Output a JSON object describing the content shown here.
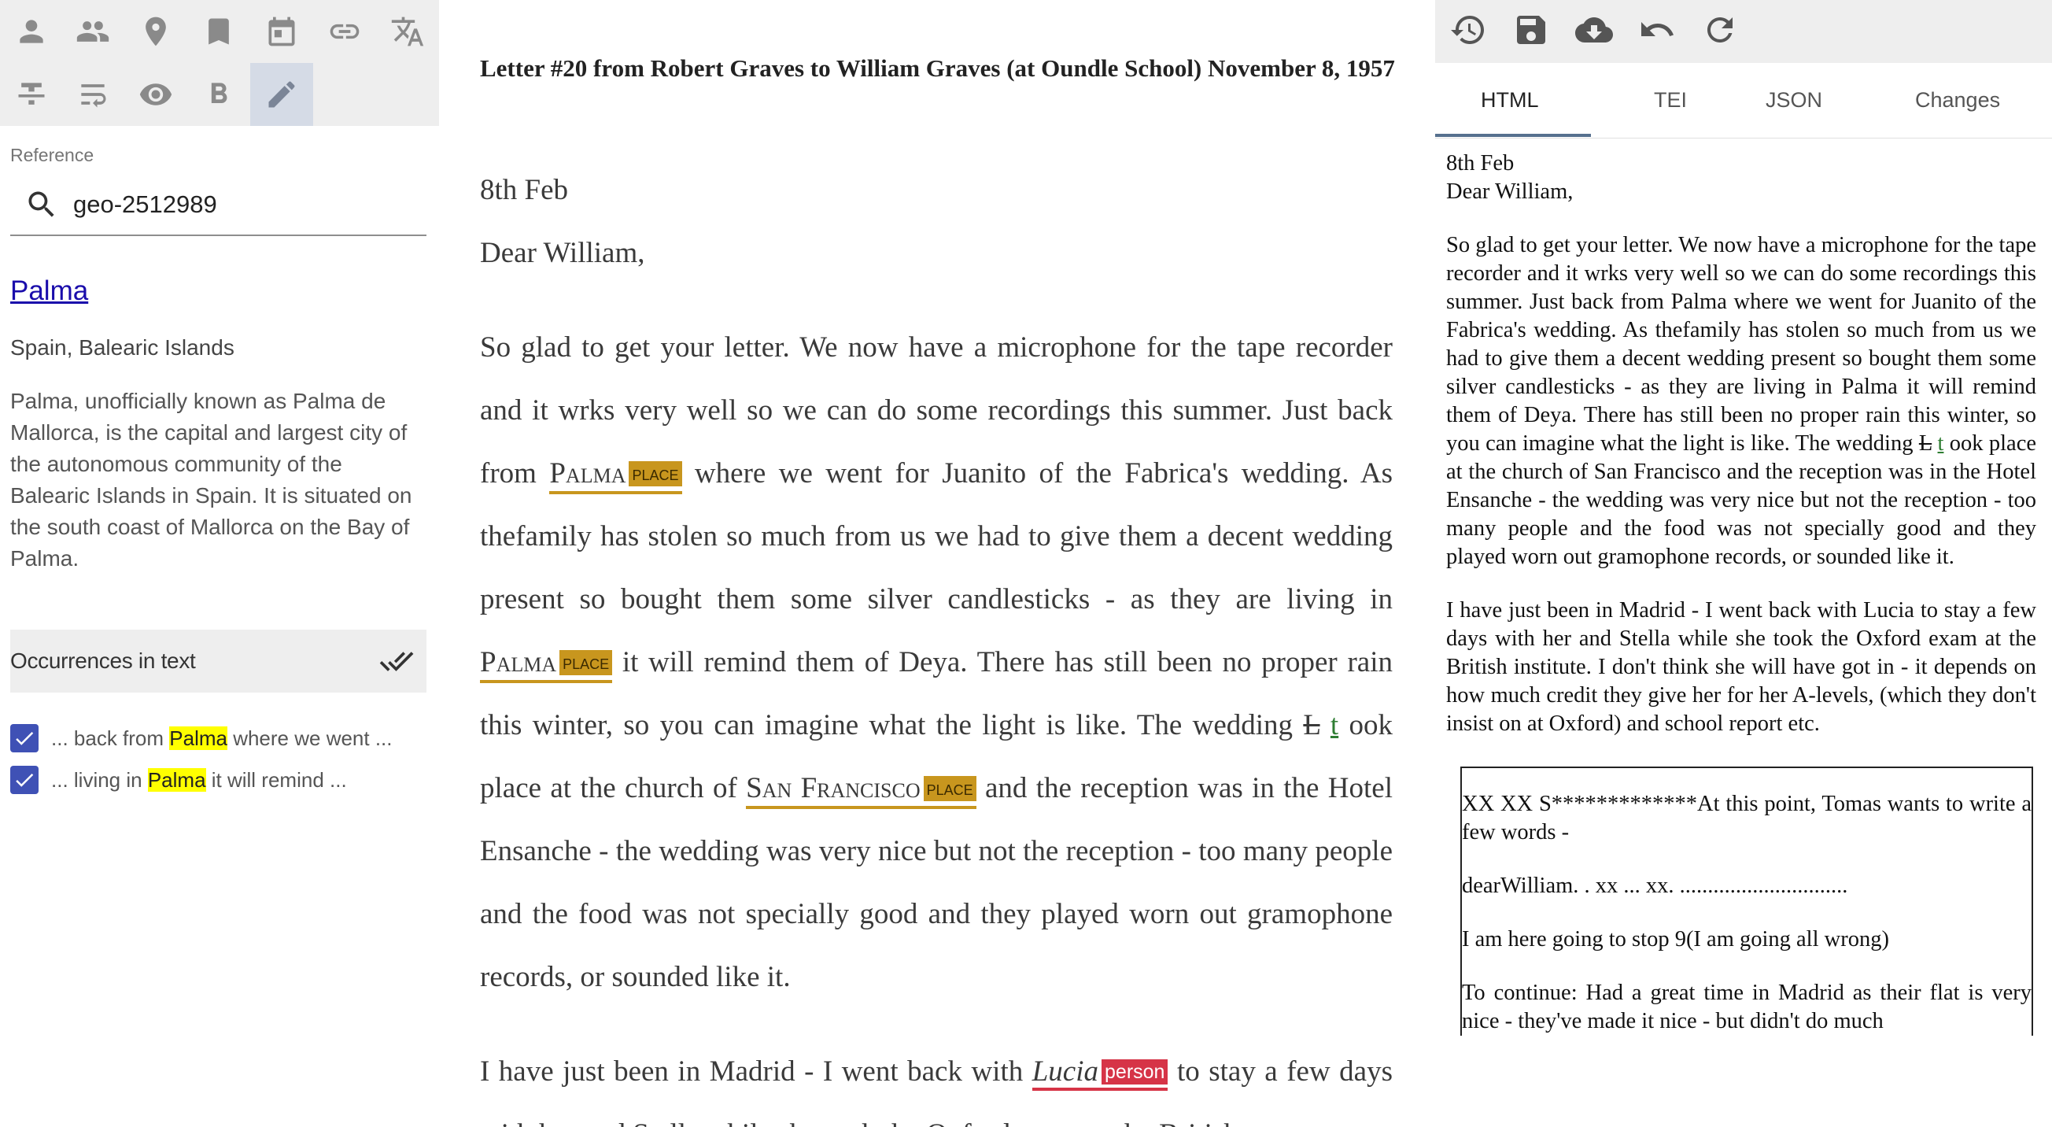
{
  "toolbar_left": {
    "row1": [
      "person-icon",
      "people-icon",
      "place-icon",
      "bookmark-icon",
      "calendar-icon",
      "link-icon",
      "translate-icon"
    ],
    "row2": [
      "strikethrough-icon",
      "wrap-text-icon",
      "eye-icon",
      "bold-icon",
      "edit-icon"
    ]
  },
  "reference": {
    "label": "Reference",
    "value": "geo-2512989"
  },
  "entity": {
    "name": "Palma",
    "location": "Spain, Balearic Islands",
    "description": "Palma, unofficially known as Palma de Mallorca, is the capital and largest city of the autonomous community of the Balearic Islands in Spain. It is situated on the south coast of Mallorca on the Bay of Palma."
  },
  "occurrences": {
    "title": "Occurrences in text",
    "items": [
      {
        "before": "... back from ",
        "match": "Palma",
        "after": " where we went ...",
        "checked": true
      },
      {
        "before": "... living in ",
        "match": "Palma",
        "after": " it will remind ...",
        "checked": true
      }
    ]
  },
  "doc": {
    "title": "Letter #20 from Robert Graves to William Graves (at Oundle School) November 8, 1957",
    "date": "8th Feb",
    "salutation": "Dear William,",
    "p1": {
      "s1": "So glad to get your letter. We now have a microphone for the tape recorder and it wrks very well so we can do some recordings this summer. Just back from ",
      "e1": "Palma",
      "s2": " where we went for Juanito of the Fabrica's wedding. As thefamily has stolen so much from us we had to give them a decent wedding present so bought them some silver candlesticks - as they are living in ",
      "e2": "Palma",
      "s3": " it will remind them of Deya. There has still been no proper rain this winter, so you can imagine what the light is like. The wedding ",
      "del": "L",
      "add": "t",
      "s4": " ook place at the church of ",
      "e3": "San Francisco",
      "s5": " and the reception was in the Hotel Ensanche - the wedding was very nice but not the reception - too many people and the food was not specially good and they played worn out gramophone records, or sounded like it."
    },
    "p2": {
      "s1": "I have just been in Madrid - I went back with ",
      "e1": "Lucia",
      "s2": " to stay a few days with her and Stella while she took the Oxford exam at the British"
    },
    "tag_place": "place",
    "tag_person": "person"
  },
  "toolbar_right": [
    "history-icon",
    "save-icon",
    "cloud-download-icon",
    "undo-icon",
    "redo-icon"
  ],
  "tabs": [
    "HTML",
    "TEI",
    "JSON",
    "Changes"
  ],
  "preview": {
    "date": "8th Feb",
    "salutation": "Dear William,",
    "p1a": "So glad to get your letter. We now have a microphone for the tape recorder and it wrks very well so we can do some recordings this summer. Just back from Palma where we went for Juanito of the Fabrica's wedding. As thefamily has stolen so much from us we had to give them a decent wedding present so bought them some silver candlesticks - as they are living in Palma it will remind them of Deya. There has still been no proper rain this winter, so you can imagine what the light is like. The wedding ",
    "p1del": "L",
    "p1add": "t",
    "p1b": " ook place at the church of San Francisco and the reception was in the Hotel Ensanche - the wedding was very nice but not the reception - too many people and the food was not specially good and they played worn out gramophone records, or sounded like it.",
    "p2": "I have just been in Madrid - I went back with Lucia to stay a few days with her and Stella while she took the Oxford exam at the British institute. I don't think she will have got in - it depends on how much credit they give her for her A-levels, (which they don't insist on at Oxford) and school report etc.",
    "note1": "XX XX S*************At this point, Tomas wants to write a few words -",
    "note2": "dearWilliam. . xx ... xx. ..............................",
    "note3": "I am here going to stop 9(I am going all wrong)",
    "note4": "To continue: Had a great time in Madrid as their flat is very nice - they've made it nice - but didn't do much"
  }
}
